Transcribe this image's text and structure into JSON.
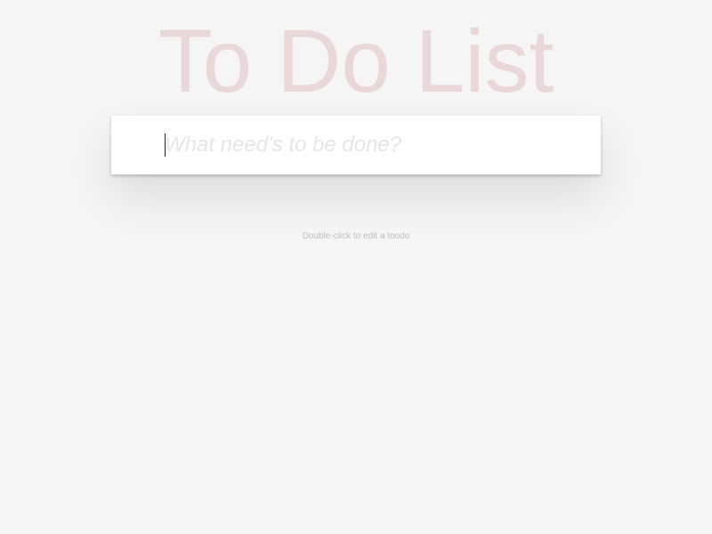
{
  "header": {
    "title": "To Do List"
  },
  "new_todo": {
    "value": "",
    "placeholder": "What need's to be done?"
  },
  "footer_info": {
    "hint": "Double-click to edit a toodo"
  },
  "colors": {
    "background": "#f5f5f5",
    "title": "#af2f2f",
    "panel": "#ffffff",
    "placeholder": "#e6e6e6",
    "hint": "#bfbfbf"
  }
}
